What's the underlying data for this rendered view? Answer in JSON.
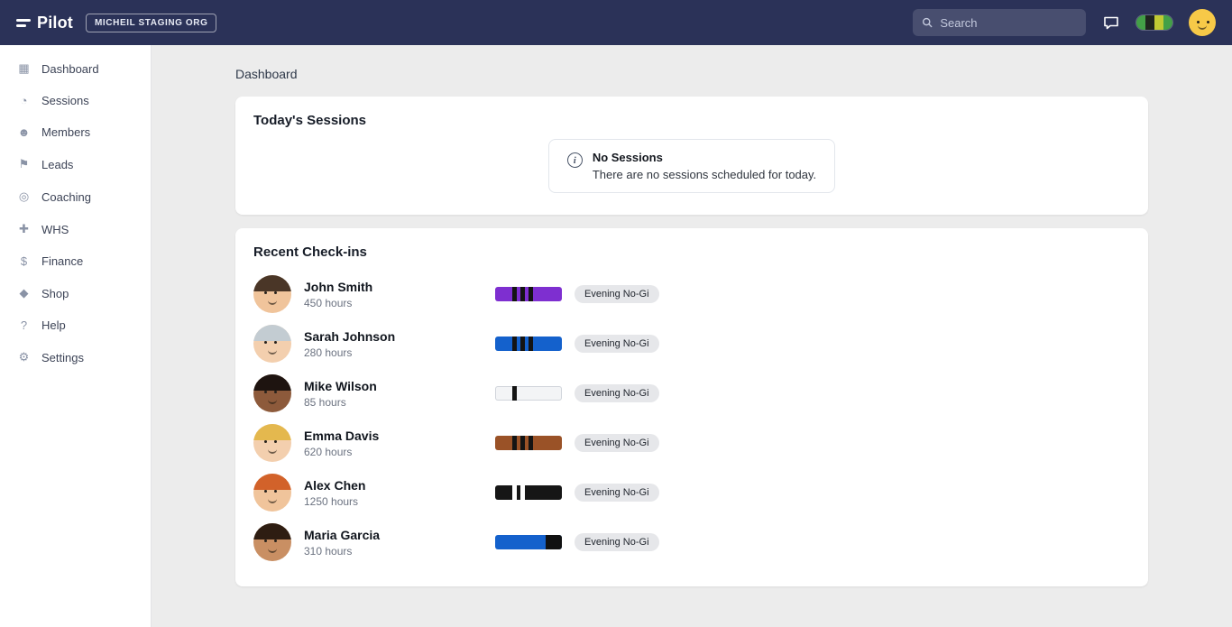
{
  "theme": {
    "topbar_color": "#2b3258",
    "accent_blue": "#1565d8"
  },
  "topbar": {
    "logo_text": "Pilot",
    "org_badge": "MICHEIL STAGING ORG",
    "search_placeholder": "Search",
    "user_belt_segments": [
      "#43a047",
      "#1f251f",
      "#c0ca33",
      "#43a047"
    ]
  },
  "sidebar": {
    "items": [
      {
        "label": "Dashboard",
        "icon": "▦"
      },
      {
        "label": "Sessions",
        "icon": "◔"
      },
      {
        "label": "Members",
        "icon": "☻"
      },
      {
        "label": "Leads",
        "icon": "⚑"
      },
      {
        "label": "Coaching",
        "icon": "◎"
      },
      {
        "label": "WHS",
        "icon": "✚"
      },
      {
        "label": "Finance",
        "icon": "$"
      },
      {
        "label": "Shop",
        "icon": "◆"
      },
      {
        "label": "Help",
        "icon": "?"
      },
      {
        "label": "Settings",
        "icon": "⚙"
      }
    ]
  },
  "main": {
    "breadcrumb": "Dashboard",
    "today_sessions": {
      "title": "Today's Sessions",
      "alert_title": "No Sessions",
      "alert_text": "There are no sessions scheduled for today."
    },
    "recent_checkins": {
      "title": "Recent Check-ins",
      "members": [
        {
          "name": "John Smith",
          "hours": "450 hours",
          "badge": "Evening No-Gi",
          "belt": {
            "color": "#7e2fd0",
            "stripes": 3,
            "stripe_color": "#141414",
            "right_patch": false
          },
          "avatar": {
            "skin": "#f0c49b",
            "hair": "#4a3627"
          }
        },
        {
          "name": "Sarah Johnson",
          "hours": "280 hours",
          "badge": "Evening No-Gi",
          "belt": {
            "color": "#1461cc",
            "stripes": 3,
            "stripe_color": "#141414",
            "right_patch": false
          },
          "avatar": {
            "skin": "#f3cfae",
            "hair": "#c3ccd2"
          }
        },
        {
          "name": "Mike Wilson",
          "hours": "85 hours",
          "badge": "Evening No-Gi",
          "belt": {
            "color": "#f3f4f6",
            "stripes": 1,
            "stripe_color": "#141414",
            "right_patch": false
          },
          "avatar": {
            "skin": "#8d5a3b",
            "hair": "#1e1410"
          }
        },
        {
          "name": "Emma Davis",
          "hours": "620 hours",
          "badge": "Evening No-Gi",
          "belt": {
            "color": "#9a5227",
            "stripes": 3,
            "stripe_color": "#141414",
            "right_patch": false
          },
          "avatar": {
            "skin": "#f3cfae",
            "hair": "#e4b84e"
          }
        },
        {
          "name": "Alex Chen",
          "hours": "1250 hours",
          "badge": "Evening No-Gi",
          "belt": {
            "color": "#161616",
            "stripes": 2,
            "stripe_color": "#ffffff",
            "right_patch": false
          },
          "avatar": {
            "skin": "#f0c49b",
            "hair": "#d2622a"
          }
        },
        {
          "name": "Maria Garcia",
          "hours": "310 hours",
          "badge": "Evening No-Gi",
          "belt": {
            "color": "#1461cc",
            "stripes": 0,
            "stripe_color": "#141414",
            "right_patch": true
          },
          "avatar": {
            "skin": "#c98f63",
            "hair": "#2e1d12"
          }
        }
      ]
    }
  }
}
